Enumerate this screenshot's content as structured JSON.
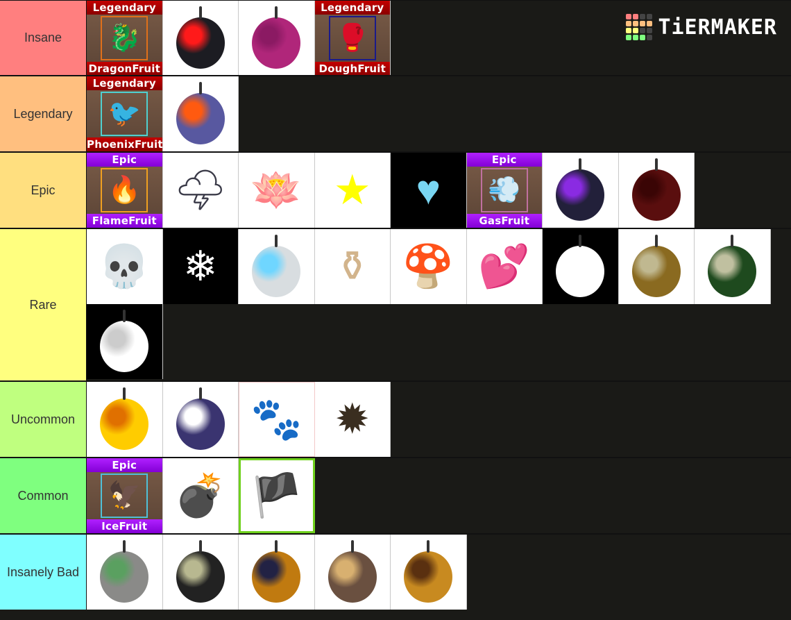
{
  "logo": {
    "text": "TiERMAKER",
    "grid_colors": [
      "#ff7f7f",
      "#ff7f7f",
      "#444",
      "#444",
      "#ffbf7f",
      "#ffbf7f",
      "#ffbf7f",
      "#ffbf7f",
      "#ffff7f",
      "#ffff7f",
      "#444",
      "#444",
      "#7fff7f",
      "#7fff7f",
      "#7fff7f",
      "#444"
    ]
  },
  "tiers": [
    {
      "label": "Insane",
      "color": "#ff7f7f",
      "items": [
        {
          "type": "card",
          "rarity": "Legendary",
          "name": "DragonFruit",
          "frame": "#e0701a",
          "glyph": "🐉",
          "name_id": "dragon-fruit-card"
        },
        {
          "type": "fruit",
          "desc": "black fruit with red cube",
          "fill": "#1c1c22",
          "accent": "#ff1a1a",
          "name_id": "rumble-cube-fruit"
        },
        {
          "type": "fruit",
          "desc": "purple swirl fruit",
          "fill": "#b0267a",
          "accent": "#8b1a63",
          "name_id": "purple-swirl-fruit"
        },
        {
          "type": "card",
          "rarity": "Legendary",
          "name": "DoughFruit",
          "frame": "#1a1a8a",
          "glyph": "🥊",
          "name_id": "dough-fruit-card"
        }
      ]
    },
    {
      "label": "Legendary",
      "color": "#ffbf7f",
      "items": [
        {
          "type": "card",
          "rarity": "Legendary",
          "name": "PhoenixFruit",
          "frame": "#4fd0d0",
          "glyph": "🐦",
          "name_id": "phoenix-fruit-card"
        },
        {
          "type": "fruit",
          "desc": "half blue half fire fruit",
          "fill": "#5858a0",
          "accent": "#ff5a10",
          "name_id": "magma-half-fruit"
        }
      ]
    },
    {
      "label": "Epic",
      "color": "#ffdf7f",
      "items": [
        {
          "type": "card",
          "rarity": "Epic",
          "name": "FlameFruit",
          "frame": "#f0a020",
          "glyph": "🔥",
          "name_id": "flame-fruit-card"
        },
        {
          "type": "glyph",
          "glyph": "🌩",
          "color": "#3a3a48",
          "name_id": "thunder-cloud-fruit"
        },
        {
          "type": "glyph",
          "glyph": "🪷",
          "color": "#2a1a55",
          "name_id": "dark-lotus-fruit"
        },
        {
          "type": "glyph",
          "glyph": "★",
          "color": "#ffff00",
          "name_id": "star-fruit"
        },
        {
          "type": "glyph",
          "glyph": "♥",
          "color": "#79d6f2",
          "dark": true,
          "name_id": "ice-heart-fruit"
        },
        {
          "type": "card",
          "rarity": "Epic",
          "name": "GasFruit",
          "frame": "#c070a0",
          "glyph": "💨",
          "name_id": "gas-fruit-card"
        },
        {
          "type": "fruit",
          "desc": "dark purple veined fruit",
          "fill": "#22203a",
          "accent": "#8a2be2",
          "name_id": "dark-purple-fruit"
        },
        {
          "type": "fruit",
          "desc": "dark red pumpkin fruit",
          "fill": "#5a0e0e",
          "accent": "#3a0505",
          "name_id": "dark-red-fruit"
        }
      ]
    },
    {
      "label": "Rare",
      "color": "#ffff7f",
      "items": [
        {
          "type": "glyph",
          "glyph": "💀",
          "color": "#7a1a1a",
          "name_id": "skull-fruit"
        },
        {
          "type": "glyph",
          "glyph": "❄",
          "color": "#ffffff",
          "dark": true,
          "name_id": "snowflake-fruit"
        },
        {
          "type": "fruit",
          "desc": "glass cracked fruit",
          "fill": "#d8dde0",
          "accent": "#6fd6ff",
          "name_id": "barrier-fruit"
        },
        {
          "type": "glyph",
          "glyph": "⚱",
          "color": "#d2b48c",
          "name_id": "gourd-fruit"
        },
        {
          "type": "glyph",
          "glyph": "🍄",
          "color": "#e02020",
          "name_id": "mushroom-fruit"
        },
        {
          "type": "glyph",
          "glyph": "💕",
          "color": "#ff9ad8",
          "name_id": "love-fruit"
        },
        {
          "type": "fruit",
          "desc": "white scribble fruit",
          "fill": "#ffffff",
          "accent": "#ffffff",
          "dark": true,
          "name_id": "scribble-fruit"
        },
        {
          "type": "fruit",
          "desc": "brown teeth fruit",
          "fill": "#8a6a20",
          "accent": "#c0b890",
          "name_id": "brown-teeth-fruit"
        },
        {
          "type": "fruit",
          "desc": "green teeth fruit",
          "fill": "#1e4a1e",
          "accent": "#c0c0a0",
          "name_id": "green-teeth-fruit"
        },
        {
          "type": "fruit",
          "desc": "white ghost fruit",
          "fill": "#ffffff",
          "accent": "#cccccc",
          "dark": true,
          "name_id": "ghost-fruit"
        }
      ]
    },
    {
      "label": "Uncommon",
      "color": "#bfff7f",
      "items": [
        {
          "type": "fruit",
          "desc": "yellow ring fruit",
          "fill": "#ffcc00",
          "accent": "#e07000",
          "name_id": "yellow-ring-fruit"
        },
        {
          "type": "fruit",
          "desc": "purple glowing fruit",
          "fill": "#3a3470",
          "accent": "#ffffff",
          "name_id": "glow-fruit"
        },
        {
          "type": "glyph",
          "glyph": "🐾",
          "color": "#f0b0b0",
          "pink_frame": true,
          "name_id": "paw-fruit"
        },
        {
          "type": "glyph",
          "glyph": "✹",
          "color": "#3a2e20",
          "name_id": "spike-fruit"
        }
      ]
    },
    {
      "label": "Common",
      "color": "#7fff7f",
      "items": [
        {
          "type": "card",
          "rarity": "Epic",
          "name": "IceFruit",
          "frame": "#4fc0d8",
          "glyph": "🦅",
          "name_id": "ice-fruit-card"
        },
        {
          "type": "glyph",
          "glyph": "💣",
          "color": "#1a1a1a",
          "name_id": "bomb-fruit"
        },
        {
          "type": "glyph",
          "glyph": "🏴",
          "color": "#7fe000",
          "green_frame": true,
          "name_id": "flag-fruit"
        }
      ]
    },
    {
      "label": "Insanely Bad",
      "color": "#7fffff",
      "items": [
        {
          "type": "fruit",
          "desc": "grey swirl fruit with leaves",
          "fill": "#8a8a88",
          "accent": "#5aa060",
          "name_id": "smoke-swirl-fruit"
        },
        {
          "type": "fruit",
          "desc": "black cat ear fruit",
          "fill": "#222222",
          "accent": "#b8b890",
          "name_id": "cat-fruit"
        },
        {
          "type": "fruit",
          "desc": "orange spotted fruit",
          "fill": "#c07a10",
          "accent": "#222244",
          "name_id": "orange-spot-fruit"
        },
        {
          "type": "fruit",
          "desc": "giraffe pattern fruit",
          "fill": "#6a5040",
          "accent": "#d8b070",
          "name_id": "giraffe-fruit"
        },
        {
          "type": "fruit",
          "desc": "striped pear fruit",
          "fill": "#c88a20",
          "accent": "#5a3010",
          "name_id": "striped-pear-fruit"
        }
      ]
    }
  ]
}
